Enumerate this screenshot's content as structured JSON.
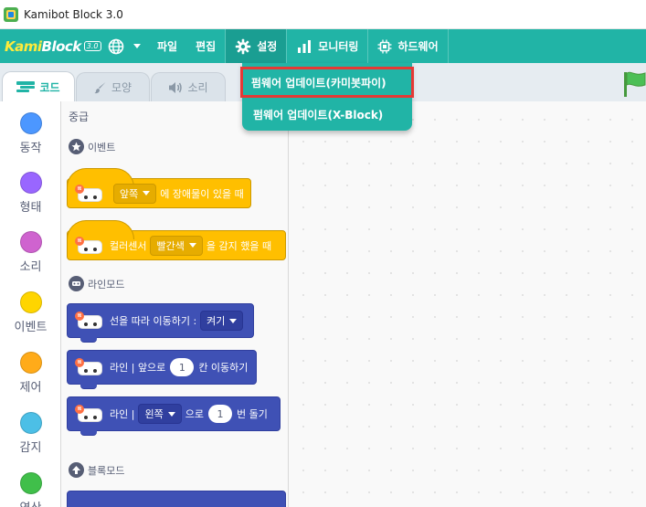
{
  "window": {
    "title": "Kamibot Block 3.0"
  },
  "menubar": {
    "logo_part1": "Kami",
    "logo_part2": "Block",
    "logo_version": "3.0",
    "items": [
      {
        "label": "파일"
      },
      {
        "label": "편집"
      },
      {
        "label": "설정"
      },
      {
        "label": "모니터링"
      },
      {
        "label": "하드웨어"
      }
    ]
  },
  "tabs": [
    {
      "label": "코드",
      "active": true
    },
    {
      "label": "모양",
      "active": false
    },
    {
      "label": "소리",
      "active": false
    }
  ],
  "categories": [
    {
      "label": "동작",
      "color": "#4c97ff"
    },
    {
      "label": "형태",
      "color": "#9966ff"
    },
    {
      "label": "소리",
      "color": "#cf63cf"
    },
    {
      "label": "이벤트",
      "color": "#ffd500"
    },
    {
      "label": "제어",
      "color": "#ffab19"
    },
    {
      "label": "감지",
      "color": "#4cbfe6"
    },
    {
      "label": "연산",
      "color": "#40bf4a"
    }
  ],
  "palette": {
    "heading": "중급",
    "sections": {
      "events": "이벤트",
      "linemode": "라인모드",
      "blockmode": "블록모드"
    },
    "blocks": {
      "b1_drop": "앞쪽",
      "b1_text": "에 장애물이 있을 때",
      "b2_text1": "컬러센서",
      "b2_drop": "빨간색",
      "b2_text2": "을 감지 했을 때",
      "b3_text": "선을 따라 이동하기 :",
      "b3_drop": "켜기",
      "b4_text1": "라인 | 앞으로",
      "b4_num": "1",
      "b4_text2": "칸 이동하기",
      "b5_text1": "라인 |",
      "b5_drop": "왼쪽",
      "b5_text2": "으로",
      "b5_num": "1",
      "b5_text3": "번 돌기"
    },
    "robot_badge": "π"
  },
  "settings_menu": {
    "items": [
      {
        "label": "펌웨어 업데이트(카미봇파이)",
        "highlighted": true
      },
      {
        "label": "펌웨어 업데이트(X-Block)",
        "highlighted": false
      }
    ]
  },
  "colors": {
    "brand": "#21b4a6",
    "event_block": "#ffbf00",
    "line_block": "#3f51b5",
    "highlight": "#e53935"
  }
}
